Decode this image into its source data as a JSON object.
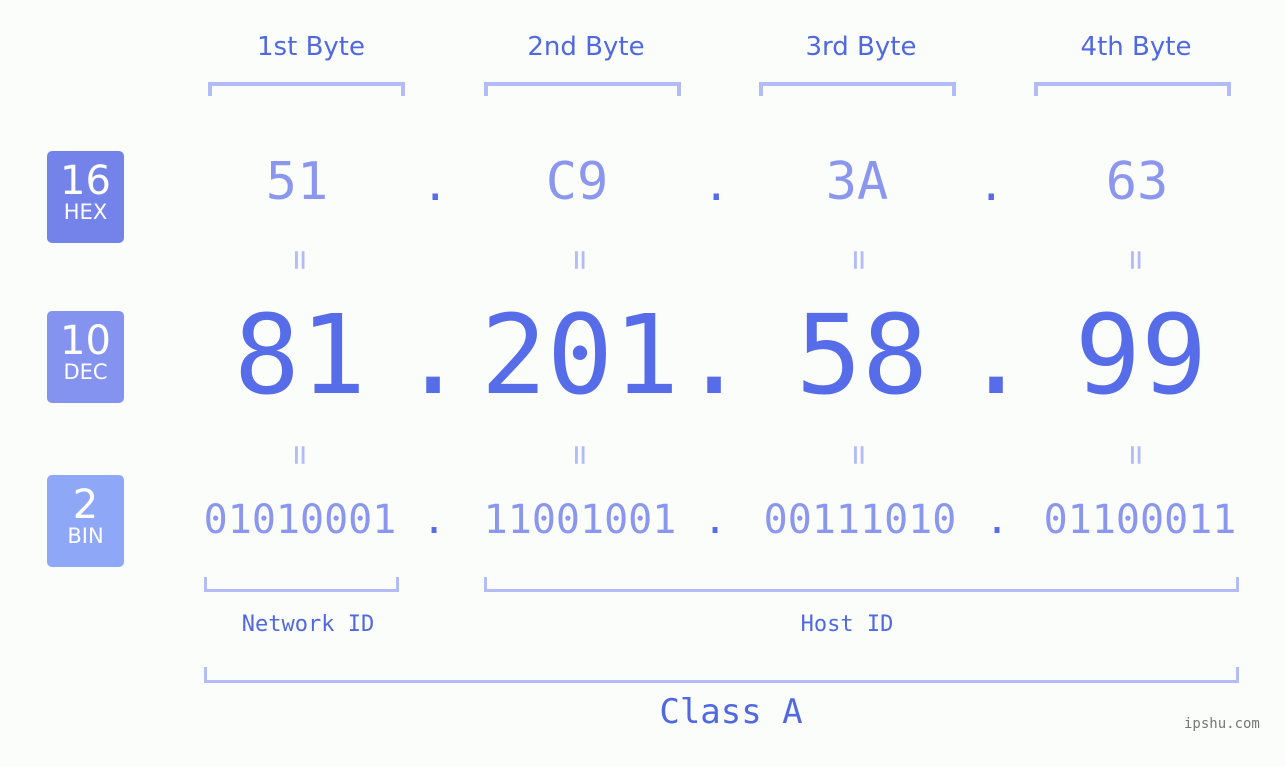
{
  "badges": [
    {
      "num": "16",
      "label": "HEX",
      "color": "#7383ea"
    },
    {
      "num": "10",
      "label": "DEC",
      "color": "#8492f0"
    },
    {
      "num": "2",
      "label": "BIN",
      "color": "#8fa7f7"
    }
  ],
  "byte_labels": [
    "1st Byte",
    "2nd Byte",
    "3rd Byte",
    "4th Byte"
  ],
  "hex": [
    "51",
    "C9",
    "3A",
    "63"
  ],
  "dec": [
    "81",
    "201",
    "58",
    "99"
  ],
  "bin": [
    "01010001",
    "11001001",
    "00111010",
    "01100011"
  ],
  "separator": ".",
  "equals": "=",
  "network_id_label": "Network ID",
  "host_id_label": "Host ID",
  "class_label": "Class A",
  "watermark": "ipshu.com",
  "colors": {
    "accent": "#566ce8",
    "light": "#8b96ef",
    "bracket": "#b3bcf6"
  }
}
